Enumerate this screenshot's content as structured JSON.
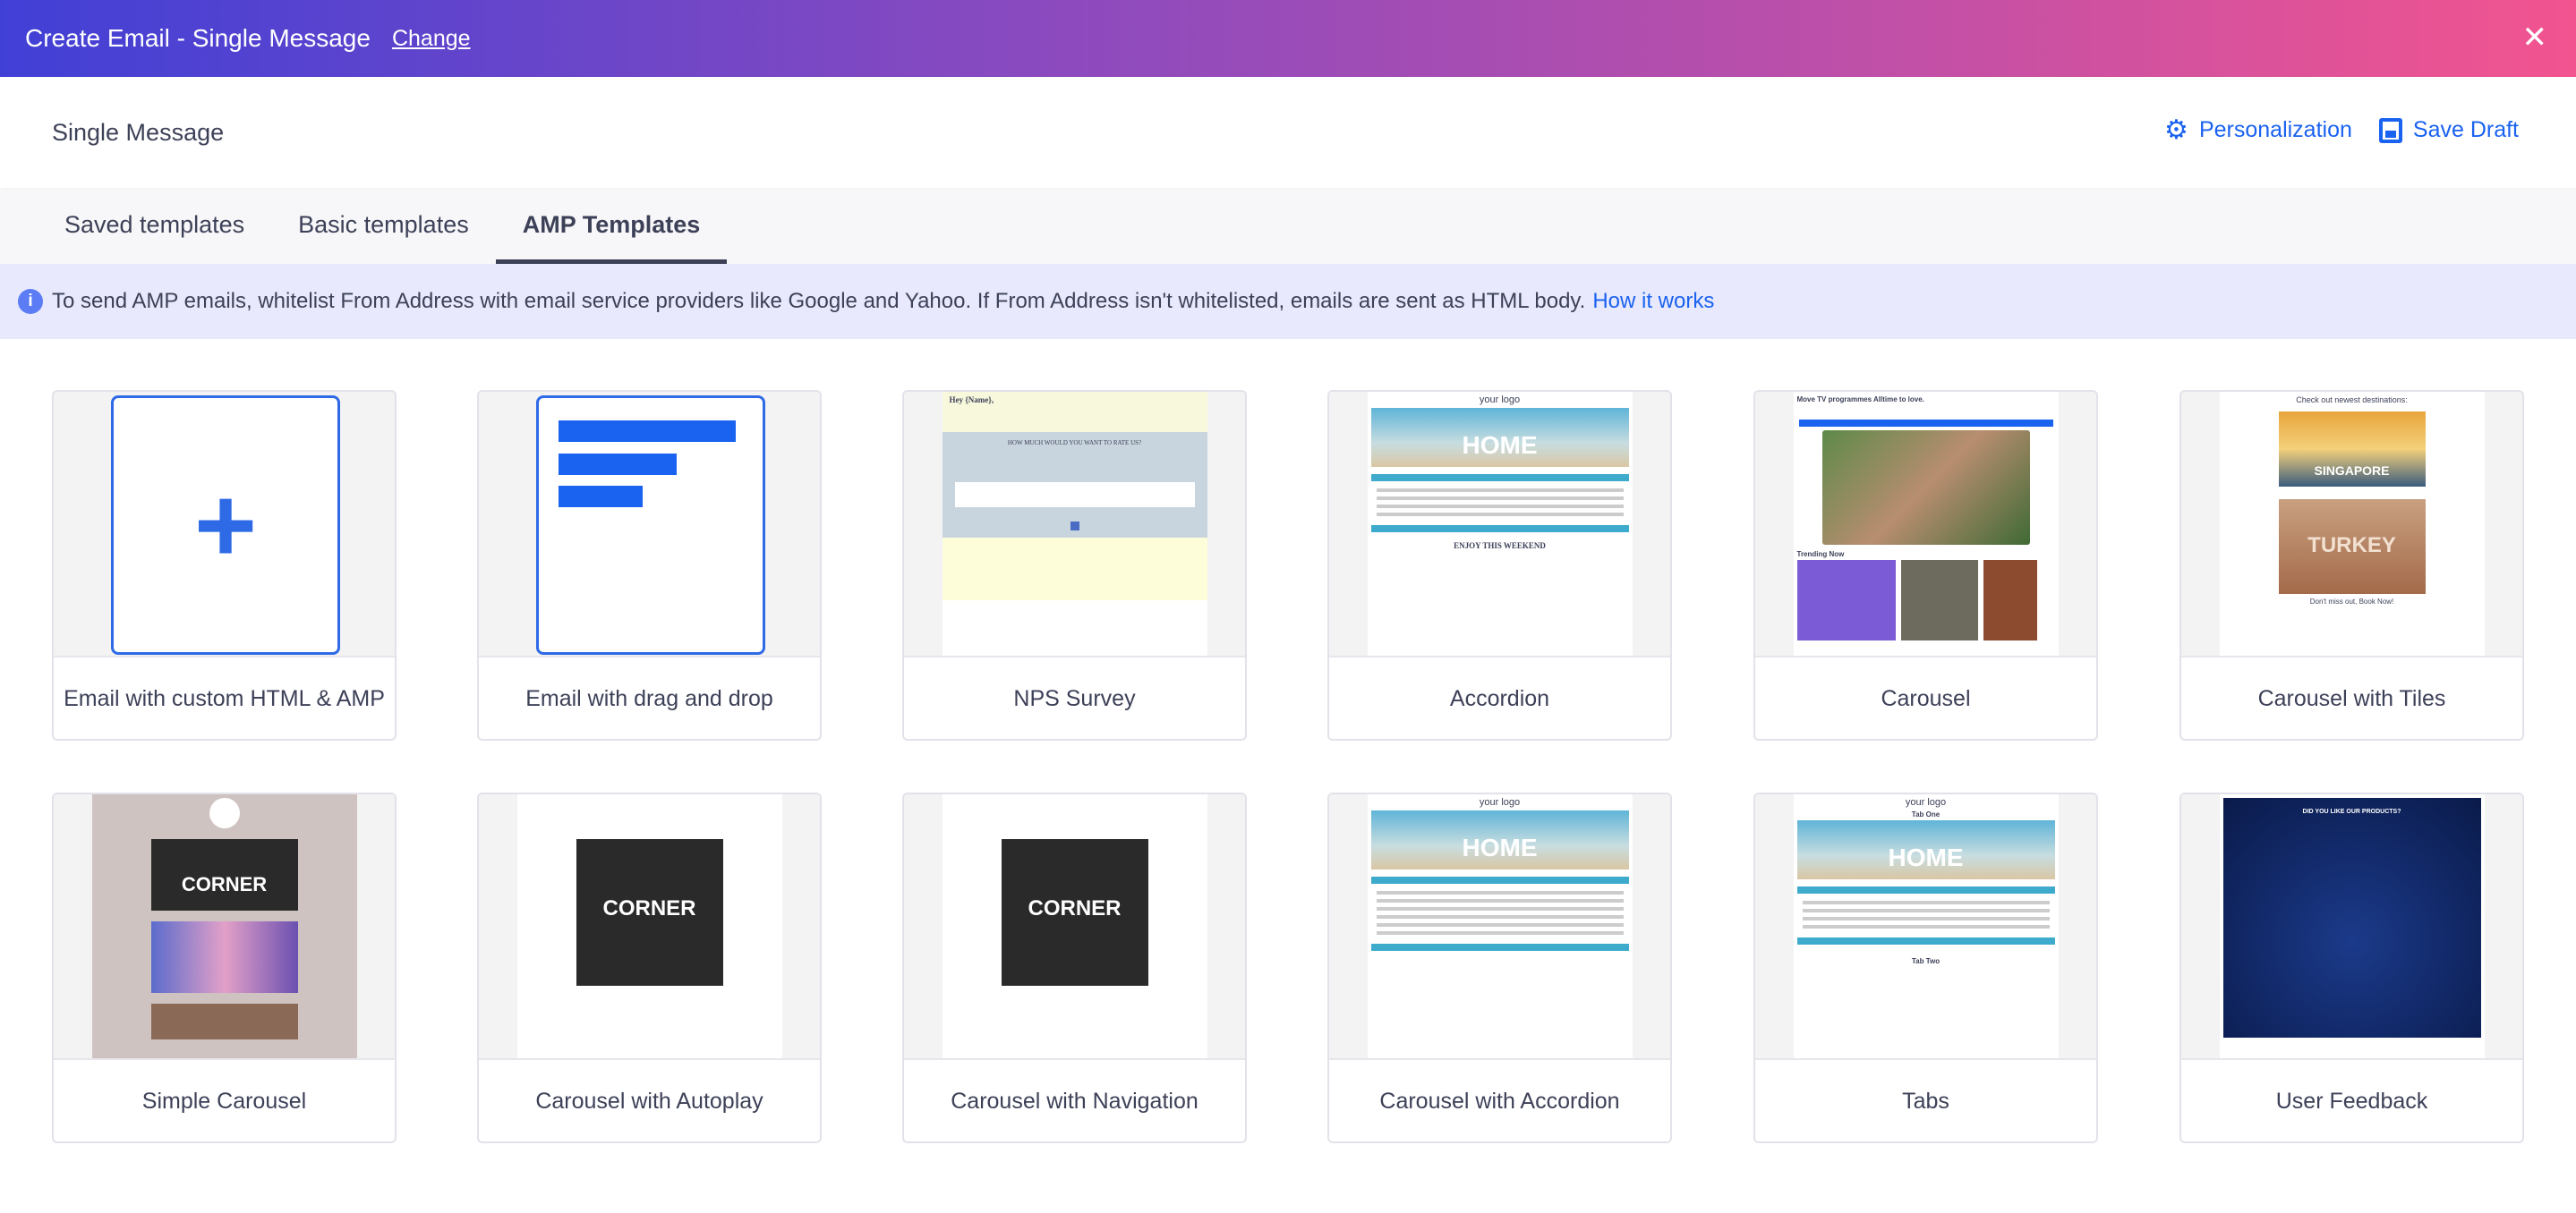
{
  "header": {
    "title": "Create Email - Single Message",
    "change_label": "Change",
    "close_icon": "close-icon"
  },
  "subheader": {
    "title": "Single Message",
    "personalization_label": "Personalization",
    "save_draft_label": "Save Draft",
    "accent": "#1a62f0"
  },
  "tabs": [
    {
      "label": "Saved templates",
      "active": false
    },
    {
      "label": "Basic templates",
      "active": false
    },
    {
      "label": "AMP Templates",
      "active": true
    }
  ],
  "banner": {
    "text": "To send AMP emails, whitelist From Address with email service providers like Google and Yahoo. If From Address isn't whitelisted, emails are sent as HTML body.",
    "link": "How it works"
  },
  "templates": [
    {
      "label": "Email with custom HTML & AMP"
    },
    {
      "label": "Email with drag and drop"
    },
    {
      "label": "NPS Survey"
    },
    {
      "label": "Accordion"
    },
    {
      "label": "Carousel"
    },
    {
      "label": "Carousel with Tiles"
    },
    {
      "label": "Simple Carousel"
    },
    {
      "label": "Carousel with Autoplay"
    },
    {
      "label": "Carousel with Navigation"
    },
    {
      "label": "Carousel with Accordion"
    },
    {
      "label": "Tabs"
    },
    {
      "label": "User Feedback"
    }
  ],
  "thumbs": {
    "logo": "your logo",
    "home": "HOME",
    "corner": "CORNER",
    "singapore": "SINGAPORE",
    "turkey": "TURKEY",
    "nps_heading": "Hey {Name},",
    "nps_question": "HOW MUCH WOULD YOU WANT TO RATE US?",
    "carousel_heading": "Move TV programmes Alltime to love.",
    "trending": "Trending Now",
    "tiles_heading": "Check out newest destinations:",
    "tiles_footer": "Don't miss out, Book Now!",
    "tab_one": "Tab One",
    "tab_two": "Tab Two",
    "enjoy": "ENJOY THIS WEEKEND",
    "feedback_q": "DID YOU LIKE OUR PRODUCTS?"
  }
}
